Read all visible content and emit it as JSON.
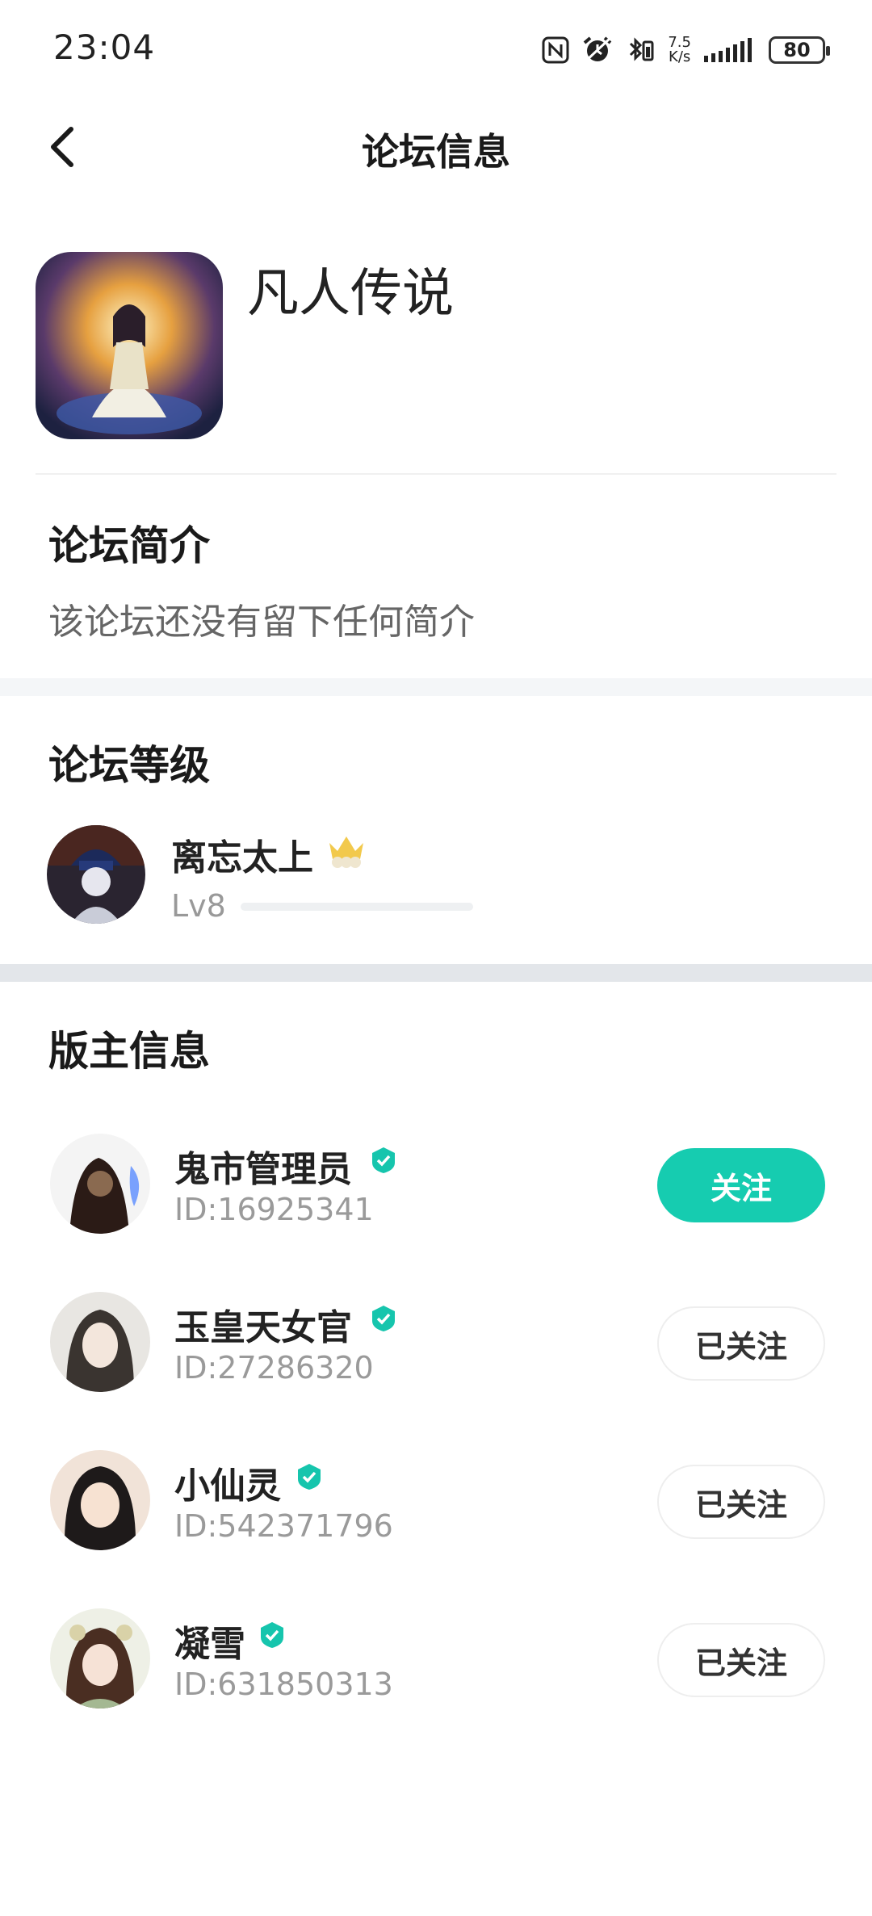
{
  "status": {
    "time": "23:04",
    "speed_value": "7.5",
    "speed_unit": "K/s",
    "battery": "80",
    "icons": [
      "nfc-icon",
      "alarm-icon",
      "bluetooth-icon",
      "signal-icon",
      "battery-icon"
    ]
  },
  "header": {
    "title": "论坛信息",
    "back_icon": "back-arrow-icon"
  },
  "forum": {
    "name": "凡人传说",
    "intro_title": "论坛简介",
    "intro_text": "该论坛还没有留下任何简介"
  },
  "level": {
    "section_title": "论坛等级",
    "user_name": "离忘太上",
    "badge_icon": "crown-icon",
    "level_label": "Lv8",
    "progress": 0.0
  },
  "moderators": {
    "section_title": "版主信息",
    "items": [
      {
        "name": "鬼市管理员",
        "id": "ID:16925341",
        "button": "关注",
        "followed": false
      },
      {
        "name": "玉皇天女官",
        "id": "ID:27286320",
        "button": "已关注",
        "followed": true
      },
      {
        "name": "小仙灵",
        "id": "ID:542371796",
        "button": "已关注",
        "followed": true
      },
      {
        "name": "凝雪",
        "id": "ID:631850313",
        "button": "已关注",
        "followed": true
      }
    ]
  },
  "colors": {
    "accent": "#16ccb0",
    "verify": "#16c5ad"
  }
}
